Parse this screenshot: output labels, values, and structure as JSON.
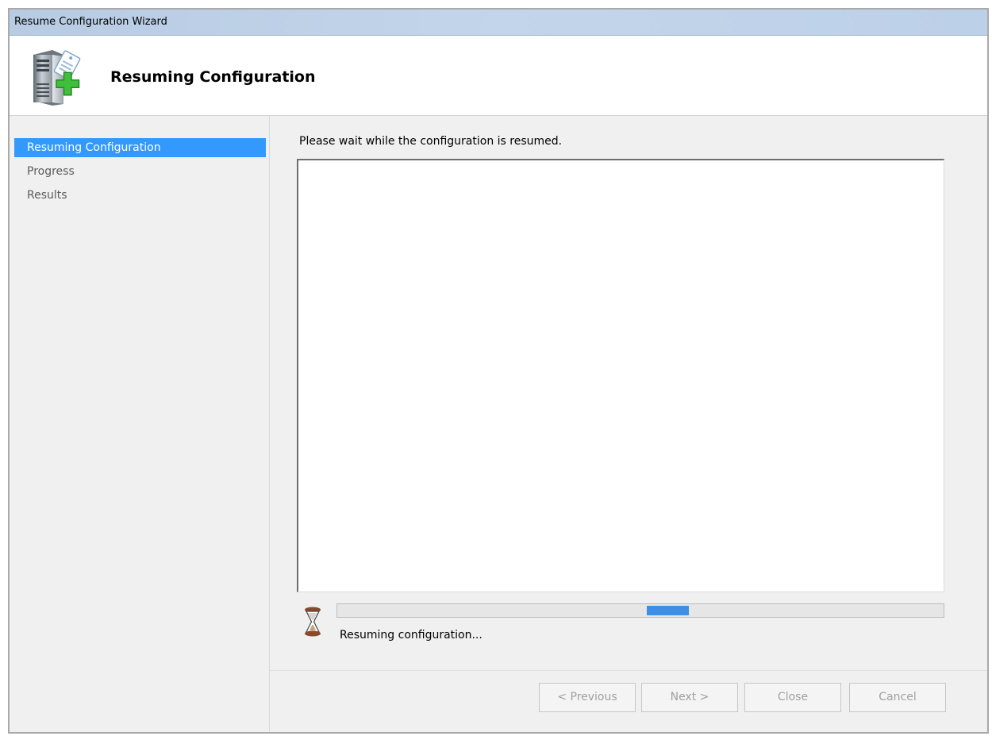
{
  "window": {
    "title": "Resume Configuration Wizard"
  },
  "header": {
    "title": "Resuming Configuration",
    "icon": "server-add-icon"
  },
  "sidebar": {
    "items": [
      {
        "label": "Resuming Configuration",
        "active": true
      },
      {
        "label": "Progress",
        "active": false
      },
      {
        "label": "Results",
        "active": false
      }
    ]
  },
  "main": {
    "instruction": "Please wait while the configuration is resumed.",
    "log_text": "",
    "status_icon": "hourglass-icon",
    "status_text": "Resuming configuration...",
    "progress": {
      "indeterminate": true,
      "marquee_position": 0.51,
      "marquee_length": 0.07
    }
  },
  "buttons": {
    "previous": "< Previous",
    "next": "Next >",
    "close": "Close",
    "cancel": "Cancel"
  },
  "colors": {
    "selection": "#3399ff",
    "progress_fill": "#3f8ee6",
    "titlebar": "#bcd0e8"
  }
}
